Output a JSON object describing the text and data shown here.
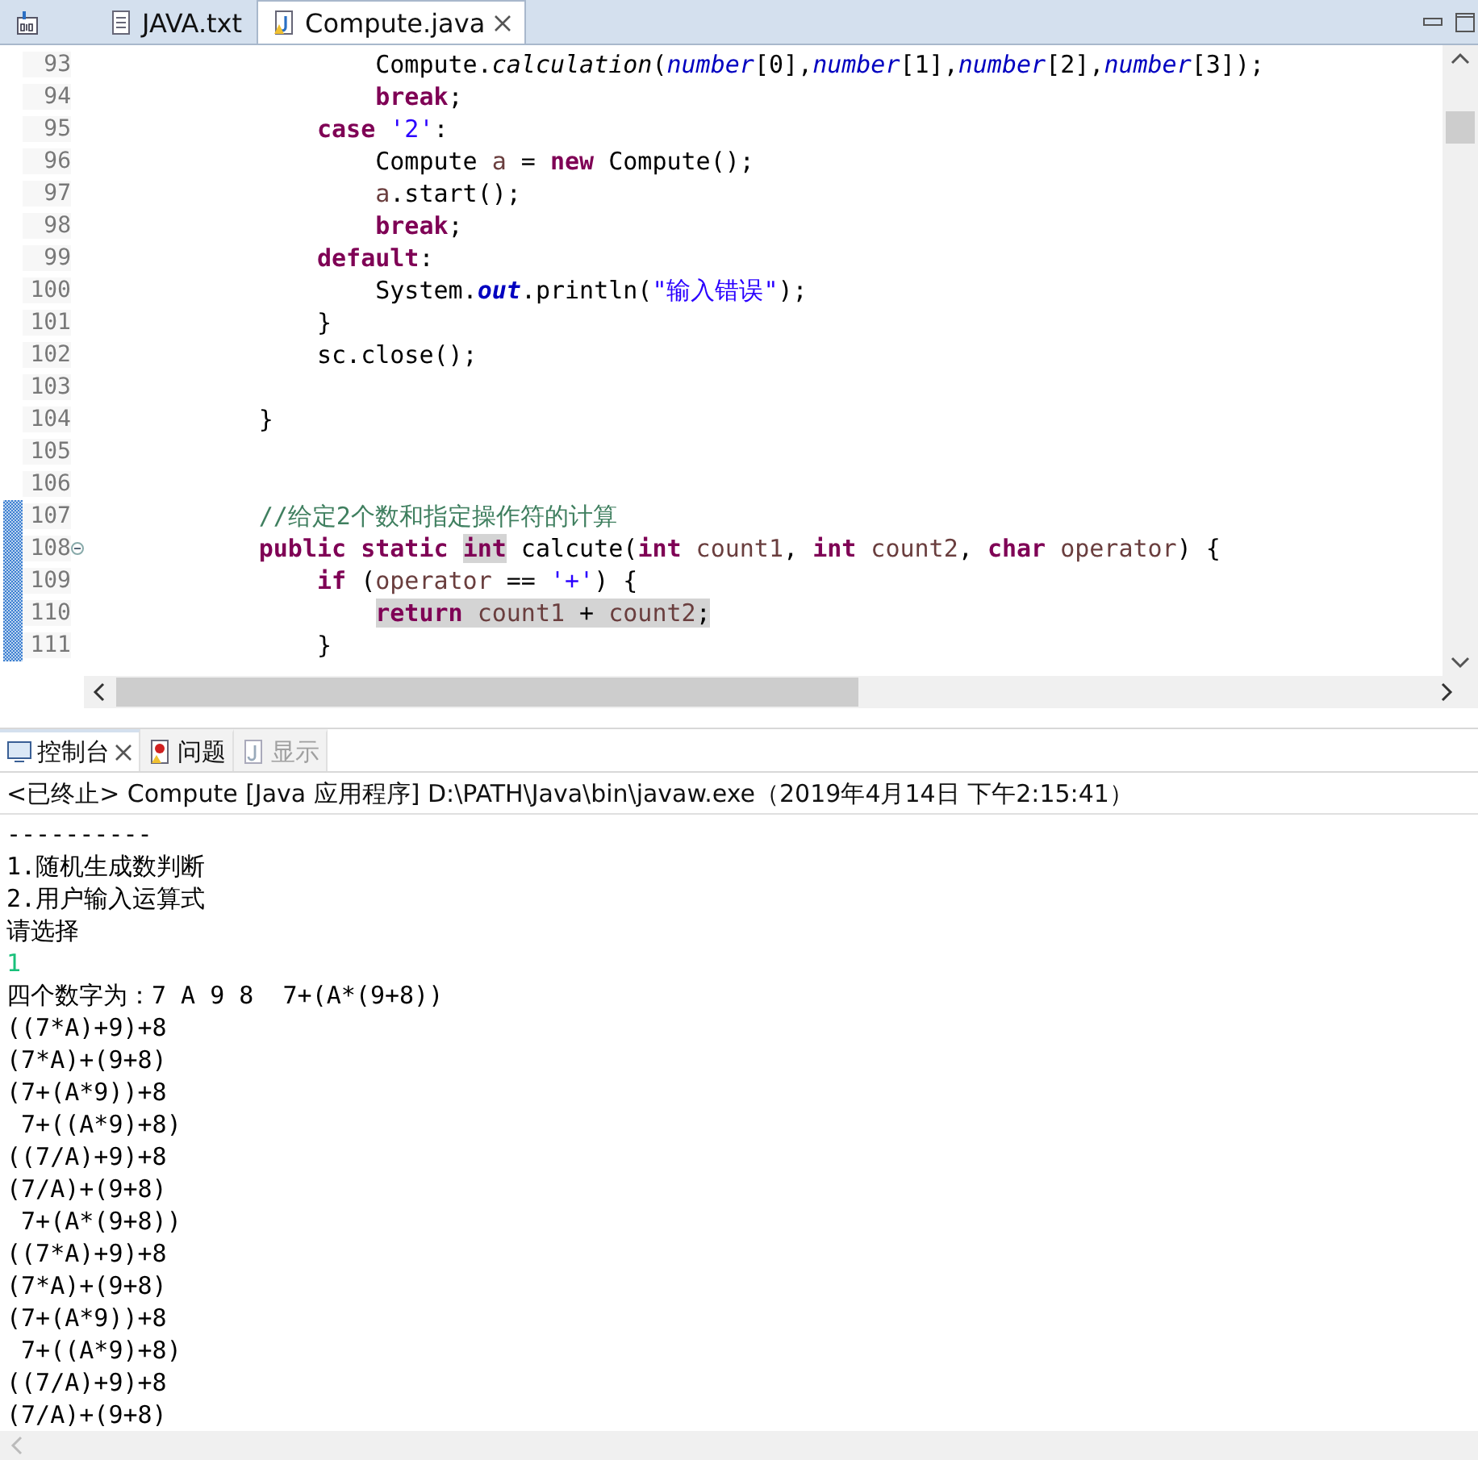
{
  "editor_tabs": [
    {
      "kind": "icon-only",
      "selected": false,
      "closable": false
    },
    {
      "kind": "text",
      "label": "JAVA.txt",
      "selected": false,
      "closable": false
    },
    {
      "kind": "java",
      "label": "Compute.java",
      "selected": true,
      "closable": true
    }
  ],
  "editor_lines": [
    {
      "number": "93",
      "changed": false,
      "tokens": [
        {
          "t": "                    Compute.",
          "kind": "plain",
          "marked": false
        },
        {
          "t": "calculation",
          "kind": "static",
          "marked": false
        },
        {
          "t": "(",
          "kind": "plain",
          "marked": false
        },
        {
          "t": "number",
          "kind": "field",
          "marked": false
        },
        {
          "t": "[0],",
          "kind": "plain",
          "marked": false
        },
        {
          "t": "number",
          "kind": "field",
          "marked": false
        },
        {
          "t": "[1],",
          "kind": "plain",
          "marked": false
        },
        {
          "t": "number",
          "kind": "field",
          "marked": false
        },
        {
          "t": "[2],",
          "kind": "plain",
          "marked": false
        },
        {
          "t": "number",
          "kind": "field",
          "marked": false
        },
        {
          "t": "[3]);",
          "kind": "plain",
          "marked": false
        }
      ]
    },
    {
      "number": "94",
      "changed": false,
      "tokens": [
        {
          "t": "                    break",
          "kind": "kw",
          "marked": false
        },
        {
          "t": ";",
          "kind": "plain",
          "marked": false
        }
      ]
    },
    {
      "number": "95",
      "changed": false,
      "tokens": [
        {
          "t": "                case",
          "kind": "kw",
          "marked": false
        },
        {
          "t": " '2'",
          "kind": "str",
          "marked": false
        },
        {
          "t": ":",
          "kind": "plain",
          "marked": false
        }
      ]
    },
    {
      "number": "96",
      "changed": false,
      "tokens": [
        {
          "t": "                    Compute ",
          "kind": "plain",
          "marked": false
        },
        {
          "t": "a",
          "kind": "var",
          "marked": false
        },
        {
          "t": " = ",
          "kind": "plain",
          "marked": false
        },
        {
          "t": "new",
          "kind": "kw",
          "marked": false
        },
        {
          "t": " Compute();",
          "kind": "plain",
          "marked": false
        }
      ]
    },
    {
      "number": "97",
      "changed": false,
      "tokens": [
        {
          "t": "                    a",
          "kind": "var",
          "marked": false
        },
        {
          "t": ".start();",
          "kind": "plain",
          "marked": false
        }
      ]
    },
    {
      "number": "98",
      "changed": false,
      "tokens": [
        {
          "t": "                    break",
          "kind": "kw",
          "marked": false
        },
        {
          "t": ";",
          "kind": "plain",
          "marked": false
        }
      ]
    },
    {
      "number": "99",
      "changed": false,
      "tokens": [
        {
          "t": "                default",
          "kind": "kw",
          "marked": false
        },
        {
          "t": ":",
          "kind": "plain",
          "marked": false
        }
      ]
    },
    {
      "number": "100",
      "changed": false,
      "tokens": [
        {
          "t": "                    System.",
          "kind": "plain",
          "marked": false
        },
        {
          "t": "out",
          "kind": "sfield",
          "marked": false
        },
        {
          "t": ".println(",
          "kind": "plain",
          "marked": false
        },
        {
          "t": "\"输入错误\"",
          "kind": "str",
          "marked": false
        },
        {
          "t": ");",
          "kind": "plain",
          "marked": false
        }
      ]
    },
    {
      "number": "101",
      "changed": false,
      "tokens": [
        {
          "t": "                }",
          "kind": "plain",
          "marked": false
        }
      ]
    },
    {
      "number": "102",
      "changed": false,
      "tokens": [
        {
          "t": "                sc.close();",
          "kind": "plain",
          "marked": false
        }
      ]
    },
    {
      "number": "103",
      "changed": false
    },
    {
      "number": "104",
      "changed": false,
      "tokens": [
        {
          "t": "            }",
          "kind": "plain",
          "marked": false
        }
      ]
    },
    {
      "number": "105",
      "changed": false
    },
    {
      "number": "106",
      "changed": false
    },
    {
      "number": "107",
      "changed": true,
      "tokens": [
        {
          "t": "            //给定2个数和指定操作符的计算",
          "kind": "comment",
          "marked": false
        }
      ]
    },
    {
      "number": "108",
      "changed": true,
      "expanded": true,
      "tokens": [
        {
          "t": "            public static ",
          "kind": "kw",
          "marked": false
        },
        {
          "t": "int",
          "kind": "kw",
          "marked": true
        },
        {
          "t": " calcute(",
          "kind": "plain",
          "marked": false
        },
        {
          "t": "int",
          "kind": "kw",
          "marked": false
        },
        {
          "t": " count1",
          "kind": "var",
          "marked": false
        },
        {
          "t": ", ",
          "kind": "plain",
          "marked": false
        },
        {
          "t": "int",
          "kind": "kw",
          "marked": false
        },
        {
          "t": " count2",
          "kind": "var",
          "marked": false
        },
        {
          "t": ", ",
          "kind": "plain",
          "marked": false
        },
        {
          "t": "char",
          "kind": "kw",
          "marked": false
        },
        {
          "t": " operator",
          "kind": "var",
          "marked": false
        },
        {
          "t": ") {",
          "kind": "plain",
          "marked": false
        }
      ]
    },
    {
      "number": "109",
      "changed": true,
      "tokens": [
        {
          "t": "                if",
          "kind": "kw",
          "marked": false
        },
        {
          "t": " (",
          "kind": "plain",
          "marked": false
        },
        {
          "t": "operator",
          "kind": "var",
          "marked": false
        },
        {
          "t": " == ",
          "kind": "plain",
          "marked": false
        },
        {
          "t": "'+'",
          "kind": "str",
          "marked": false
        },
        {
          "t": ") {",
          "kind": "plain",
          "marked": false
        }
      ]
    },
    {
      "number": "110",
      "changed": true,
      "tokens": [
        {
          "t": "                    return",
          "kind": "kw",
          "marked": true
        },
        {
          "t": " count1",
          "kind": "var",
          "marked": true
        },
        {
          "t": " + ",
          "kind": "plain",
          "marked": true
        },
        {
          "t": "count2",
          "kind": "var",
          "marked": true
        },
        {
          "t": ";",
          "kind": "plain",
          "marked": true
        }
      ]
    },
    {
      "number": "111",
      "changed": true,
      "tokens": [
        {
          "t": "                }",
          "kind": "plain",
          "marked": false
        }
      ]
    }
  ],
  "console_tabs": [
    {
      "label": "控制台",
      "selected": true,
      "disabled": false,
      "closable": true
    },
    {
      "label": "问题",
      "selected": false,
      "disabled": false,
      "closable": false
    },
    {
      "label": "显示",
      "selected": false,
      "disabled": true,
      "closable": false
    }
  ],
  "console_header": "<已终止> Compute [Java 应用程序] D:\\PATH\\Java\\bin\\javaw.exe（2019年4月14日 下午2:15:41）",
  "console_lines": [
    {
      "text": "----------",
      "kind": "output"
    },
    {
      "text": "1.随机生成数判断",
      "kind": "output"
    },
    {
      "text": "2.用户输入运算式",
      "kind": "output"
    },
    {
      "text": "请选择",
      "kind": "output"
    },
    {
      "text": "1",
      "kind": "input"
    },
    {
      "text": "四个数字为：7 A 9 8  7+(A*(9+8))",
      "kind": "output"
    },
    {
      "text": "((7*A)+9)+8",
      "kind": "output"
    },
    {
      "text": "(7*A)+(9+8)",
      "kind": "output"
    },
    {
      "text": "(7+(A*9))+8",
      "kind": "output"
    },
    {
      "text": " 7+((A*9)+8)",
      "kind": "output"
    },
    {
      "text": "((7/A)+9)+8",
      "kind": "output"
    },
    {
      "text": "(7/A)+(9+8)",
      "kind": "output"
    },
    {
      "text": " 7+(A*(9+8))",
      "kind": "output"
    },
    {
      "text": "((7*A)+9)+8",
      "kind": "output"
    },
    {
      "text": "(7*A)+(9+8)",
      "kind": "output"
    },
    {
      "text": "(7+(A*9))+8",
      "kind": "output"
    },
    {
      "text": " 7+((A*9)+8)",
      "kind": "output"
    },
    {
      "text": "((7/A)+9)+8",
      "kind": "output"
    },
    {
      "text": "(7/A)+(9+8)",
      "kind": "output"
    }
  ]
}
